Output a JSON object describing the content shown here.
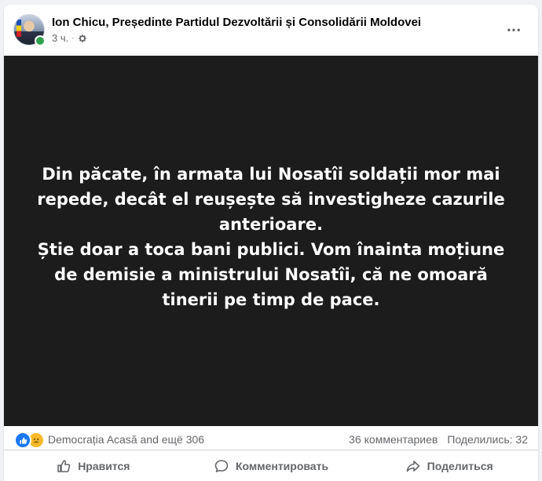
{
  "post": {
    "author": "Ion Chicu, Președinte Partidul Dezvoltării și Consolidării Moldovei",
    "time": "3 ч.",
    "separator": "·",
    "more_label": "•••"
  },
  "image": {
    "text_line1": "Din păcate, în armata lui Nosatîi soldații mor mai repede, decât el reușește să investigheze cazurile anterioare.",
    "text_line2": "Știe doar a toca bani publici. Vom înainta moțiune de demisie a ministrului Nosatîi, că ne omoară tinerii pe timp de pace."
  },
  "stats": {
    "reactors": "Democrația Acasă and ещё 306",
    "comments": "36 комментариев",
    "shares": "Поделились: 32"
  },
  "actions": {
    "like": "Нравится",
    "comment": "Комментировать",
    "share": "Поделиться"
  },
  "icons": {
    "like": "like-icon",
    "sad": "sad-reaction-icon",
    "gear": "gear-icon"
  },
  "colors": {
    "like_blue": "#1877f2",
    "sad_yellow": "#f7b928",
    "online_green": "#31a24c",
    "image_bg": "#1c1c1d"
  }
}
